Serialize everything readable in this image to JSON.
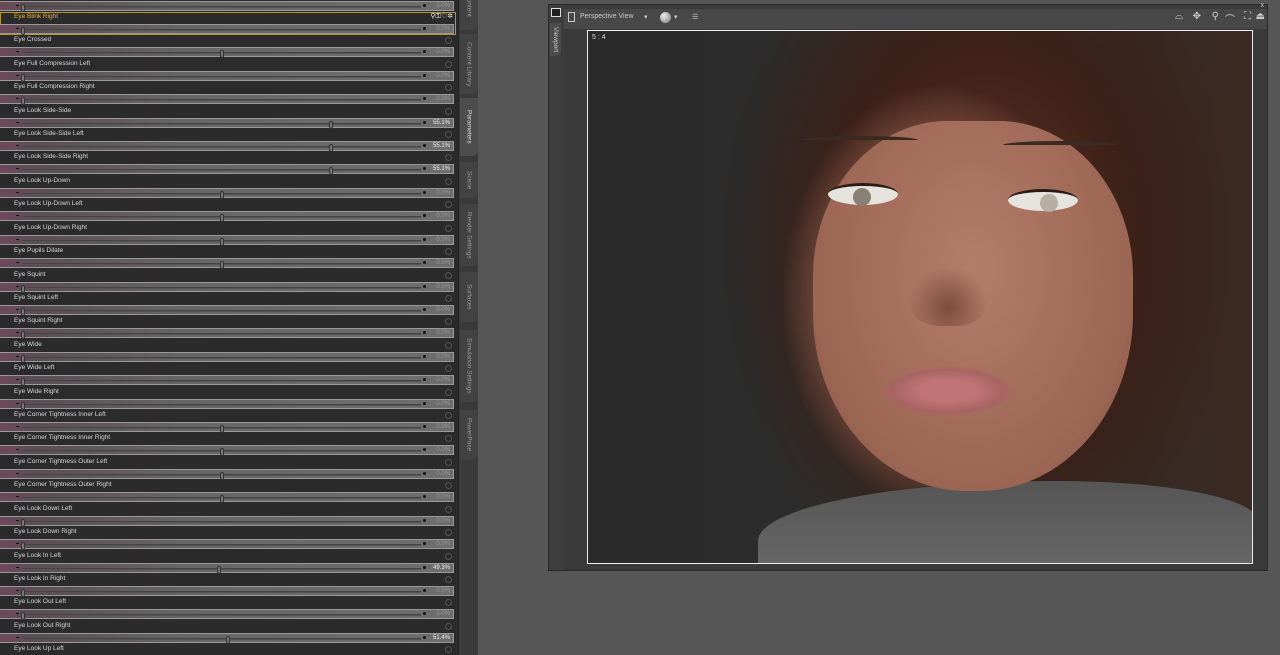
{
  "parameters": {
    "rows": [
      {
        "label": "",
        "value": "0.0%",
        "pos": 0.0
      },
      {
        "label": "Eye Blink Right",
        "value": "0.0%",
        "pos": 0.0,
        "selected": true
      },
      {
        "label": "Eye Crossed",
        "value": "0.0%",
        "pos": 0.5
      },
      {
        "label": "Eye Full Compression Left",
        "value": "0.0%",
        "pos": 0.0
      },
      {
        "label": "Eye Full Compression Right",
        "value": "0.0%",
        "pos": 0.0
      },
      {
        "label": "Eye Look Side-Side",
        "value": "55.1%",
        "pos": 0.775
      },
      {
        "label": "Eye Look Side-Side Left",
        "value": "55.1%",
        "pos": 0.775
      },
      {
        "label": "Eye Look Side-Side Right",
        "value": "55.1%",
        "pos": 0.775
      },
      {
        "label": "Eye Look Up-Down",
        "value": "0.0%",
        "pos": 0.5
      },
      {
        "label": "Eye Look Up-Down Left",
        "value": "0.0%",
        "pos": 0.5
      },
      {
        "label": "Eye Look Up-Down Right",
        "value": "0.0%",
        "pos": 0.5
      },
      {
        "label": "Eye Pupils Dilate",
        "value": "0.0%",
        "pos": 0.5
      },
      {
        "label": "Eye Squint",
        "value": "0.0%",
        "pos": 0.0
      },
      {
        "label": "Eye Squint Left",
        "value": "0.0%",
        "pos": 0.0
      },
      {
        "label": "Eye Squint Right",
        "value": "0.0%",
        "pos": 0.0
      },
      {
        "label": "Eye Wide",
        "value": "0.0%",
        "pos": 0.0
      },
      {
        "label": "Eye Wide Left",
        "value": "0.0%",
        "pos": 0.0
      },
      {
        "label": "Eye Wide Right",
        "value": "0.0%",
        "pos": 0.0
      },
      {
        "label": "Eye Corner Tightness Inner Left",
        "value": "0.0%",
        "pos": 0.5
      },
      {
        "label": "Eye Corner Tightness Inner Right",
        "value": "0.0%",
        "pos": 0.5
      },
      {
        "label": "Eye Corner Tightness Outer Left",
        "value": "0.0%",
        "pos": 0.5
      },
      {
        "label": "Eye Corner Tightness Outer Right",
        "value": "0.0%",
        "pos": 0.5
      },
      {
        "label": "Eye Look Down Left",
        "value": "0.0%",
        "pos": 0.0
      },
      {
        "label": "Eye Look Down Right",
        "value": "0.0%",
        "pos": 0.0
      },
      {
        "label": "Eye Look In Left",
        "value": "49.3%",
        "pos": 0.493
      },
      {
        "label": "Eye Look In Right",
        "value": "0.0%",
        "pos": 0.0
      },
      {
        "label": "Eye Look Out Left",
        "value": "0.0%",
        "pos": 0.0
      },
      {
        "label": "Eye Look Out Right",
        "value": "51.4%",
        "pos": 0.514
      },
      {
        "label": "Eye Look Up Left",
        "value": "",
        "pos": 0.0
      }
    ]
  },
  "side_tabs": [
    "Content",
    "Content Library",
    "Parameters",
    "Scene",
    "Render Settings",
    "Surfaces",
    "Simulation Settings",
    "PowerPose"
  ],
  "active_tab": "Parameters",
  "viewport": {
    "tab": "Viewport",
    "view": "Perspective View",
    "ratio": "5 : 4",
    "close": "x"
  }
}
